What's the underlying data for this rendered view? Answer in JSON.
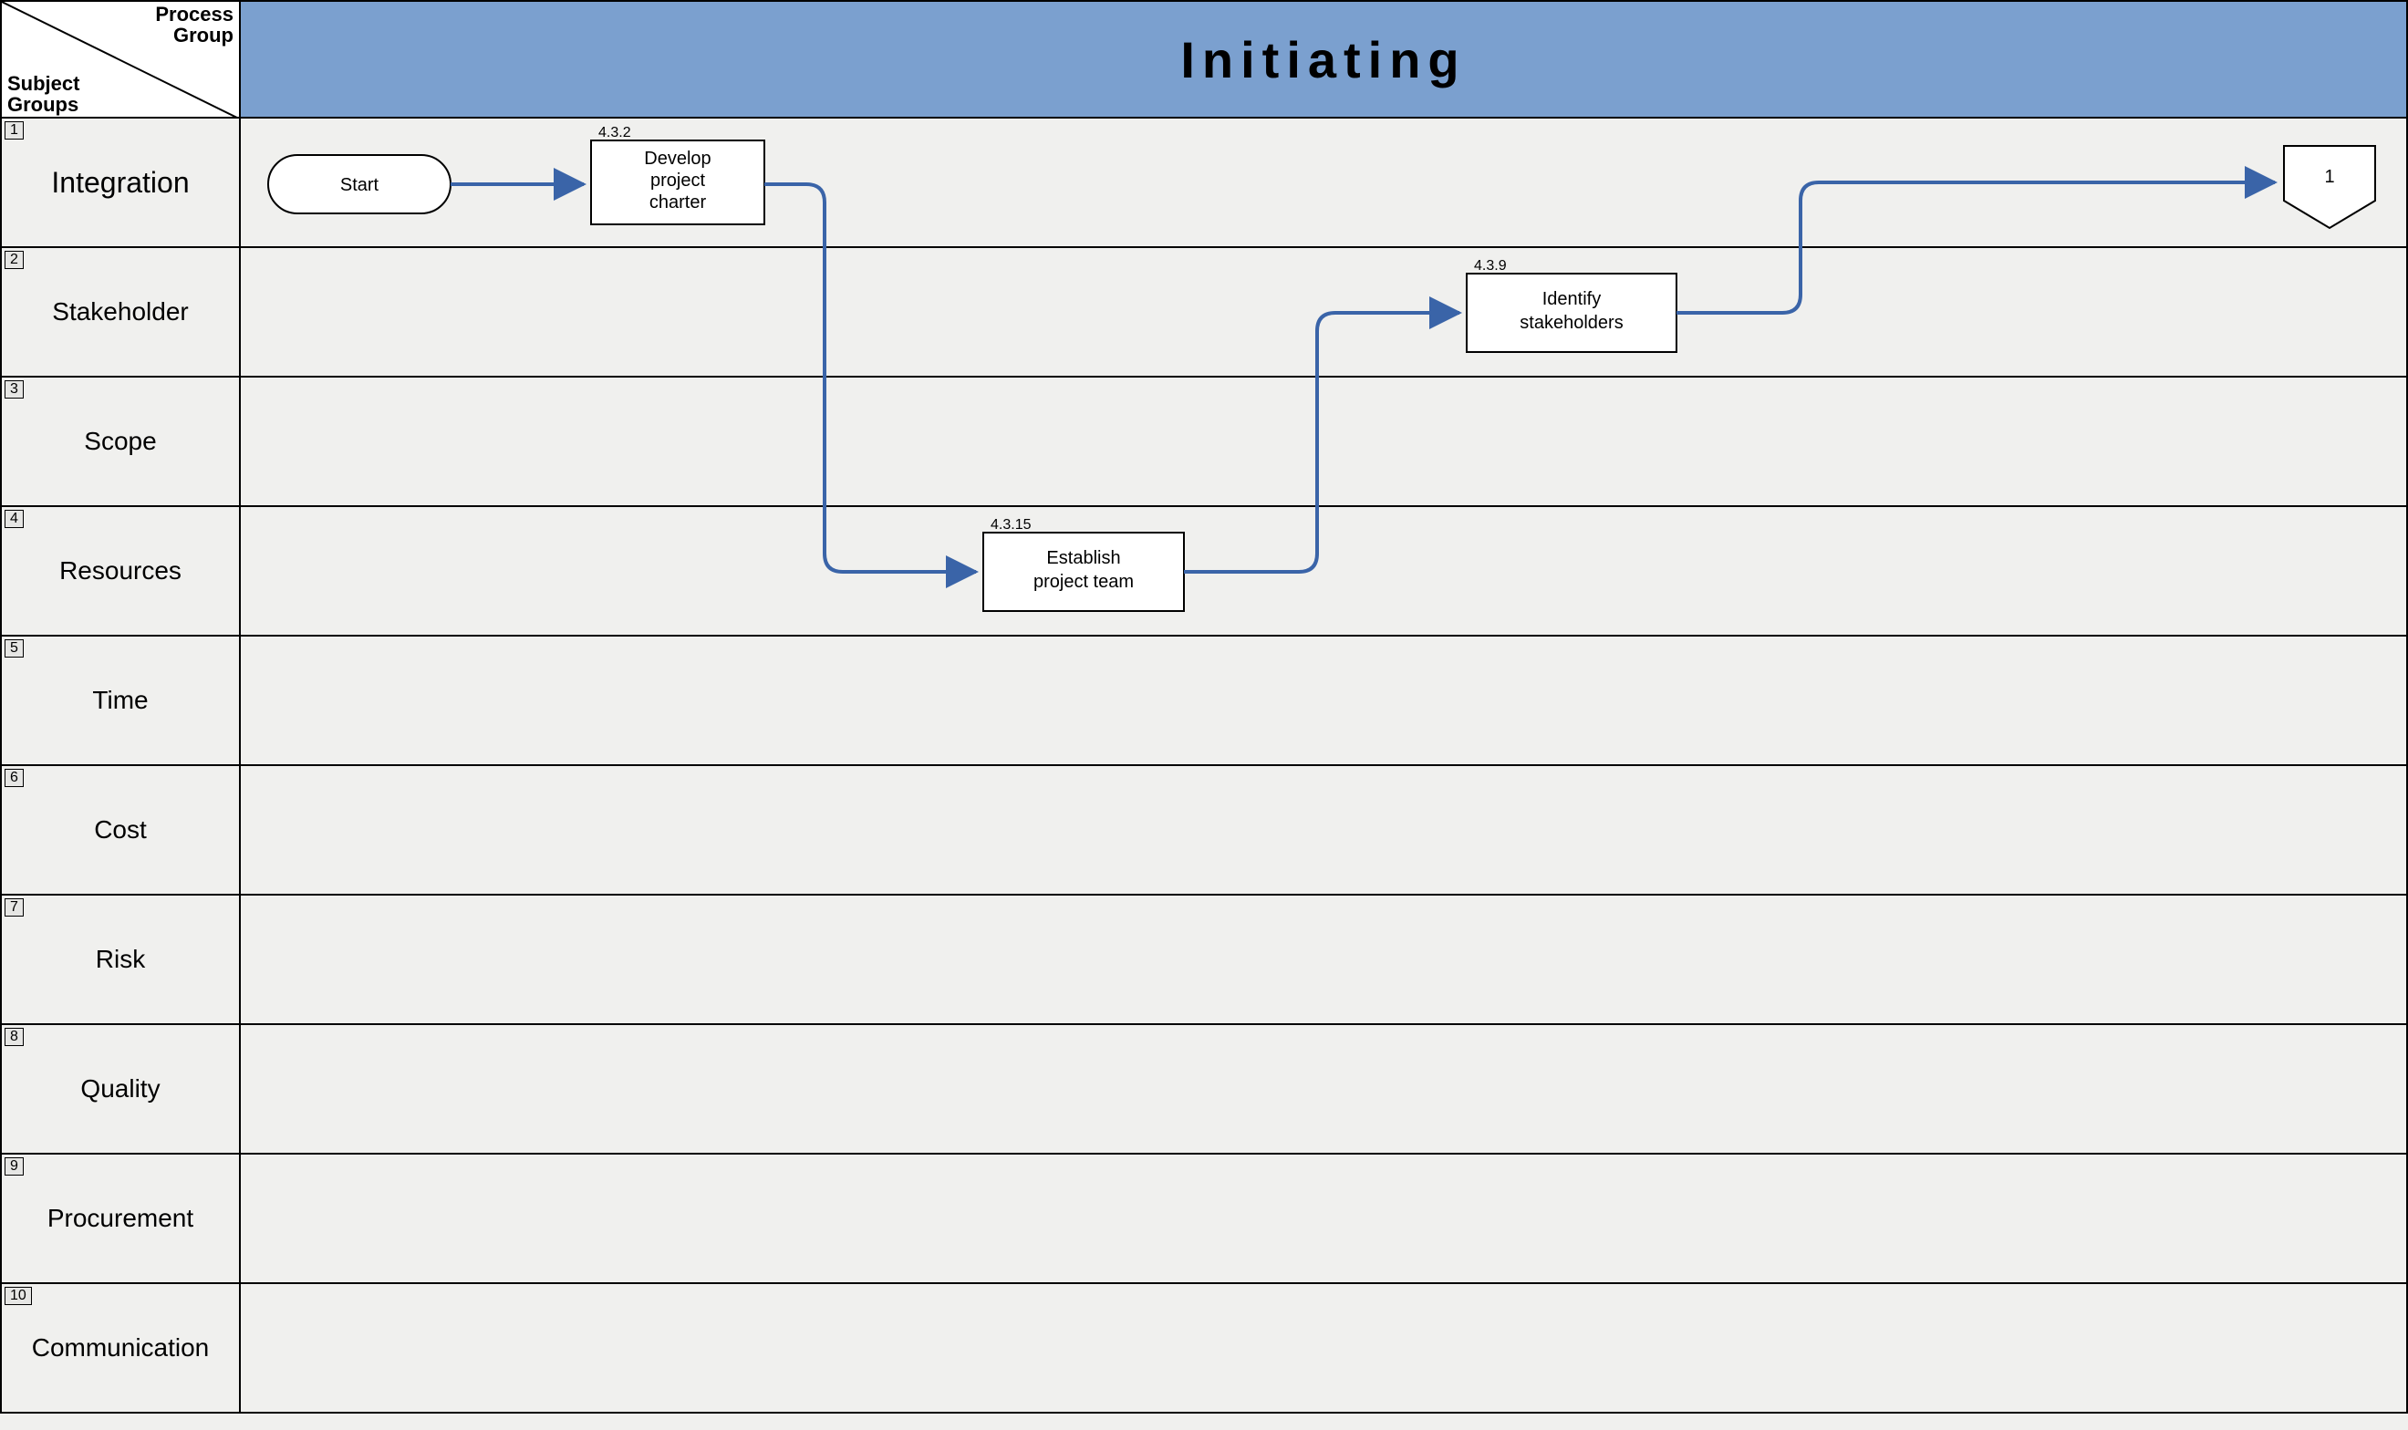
{
  "header": {
    "corner_top": "Process\nGroup",
    "corner_bottom": "Subject\nGroups",
    "title": "Initiating"
  },
  "rows": [
    {
      "n": "1",
      "label": "Integration",
      "big": true
    },
    {
      "n": "2",
      "label": "Stakeholder",
      "big": false
    },
    {
      "n": "3",
      "label": "Scope",
      "big": false
    },
    {
      "n": "4",
      "label": "Resources",
      "big": false
    },
    {
      "n": "5",
      "label": "Time",
      "big": false
    },
    {
      "n": "6",
      "label": "Cost",
      "big": false
    },
    {
      "n": "7",
      "label": "Risk",
      "big": false
    },
    {
      "n": "8",
      "label": "Quality",
      "big": false
    },
    {
      "n": "9",
      "label": "Procurement",
      "big": false
    },
    {
      "n": "10",
      "label": "Communication",
      "big": false
    }
  ],
  "nodes": {
    "start": {
      "label": "Start"
    },
    "charter": {
      "ref": "4.3.2",
      "l1": "Develop",
      "l2": "project",
      "l3": "charter"
    },
    "team": {
      "ref": "4.3.15",
      "l1": "Establish",
      "l2": "project team"
    },
    "stake": {
      "ref": "4.3.9",
      "l1": "Identify",
      "l2": "stakeholders"
    },
    "conn": {
      "label": "1"
    }
  },
  "chart_data": {
    "type": "table",
    "title": "Initiating process group – swimlane flow",
    "columns": [
      "Subject Group"
    ],
    "rows": [
      "Integration",
      "Stakeholder",
      "Scope",
      "Resources",
      "Time",
      "Cost",
      "Risk",
      "Quality",
      "Procurement",
      "Communication"
    ],
    "processes": [
      {
        "id": "start",
        "ref": null,
        "name": "Start",
        "lane": "Integration",
        "shape": "terminator"
      },
      {
        "id": "charter",
        "ref": "4.3.2",
        "name": "Develop project charter",
        "lane": "Integration",
        "shape": "process"
      },
      {
        "id": "team",
        "ref": "4.3.15",
        "name": "Establish project team",
        "lane": "Resources",
        "shape": "process"
      },
      {
        "id": "stake",
        "ref": "4.3.9",
        "name": "Identify stakeholders",
        "lane": "Stakeholder",
        "shape": "process"
      },
      {
        "id": "conn1",
        "ref": null,
        "name": "1",
        "lane": "Integration",
        "shape": "offpage-connector"
      }
    ],
    "flows": [
      [
        "start",
        "charter"
      ],
      [
        "charter",
        "team"
      ],
      [
        "team",
        "stake"
      ],
      [
        "stake",
        "conn1"
      ]
    ]
  }
}
